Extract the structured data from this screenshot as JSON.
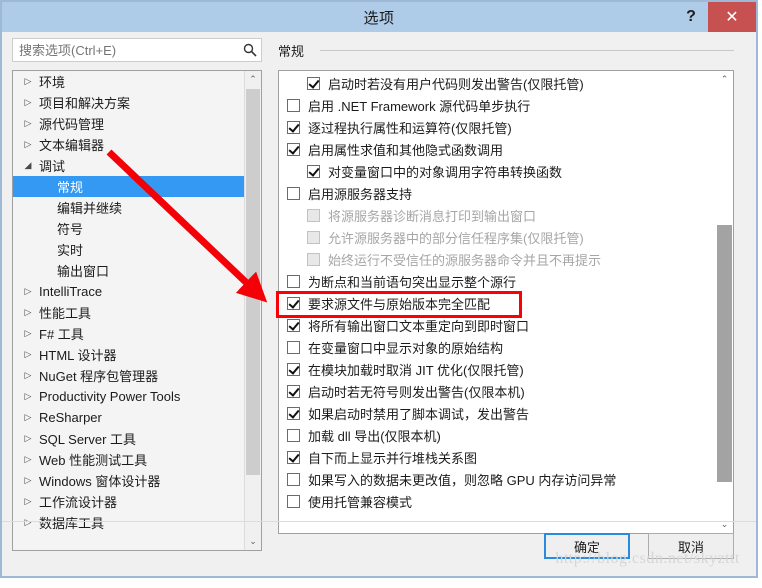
{
  "window": {
    "title": "选项",
    "help_label": "?",
    "close_label": "✕"
  },
  "search": {
    "placeholder": "搜索选项(Ctrl+E)",
    "value": "",
    "icon": "search-icon"
  },
  "section": {
    "title": "常规"
  },
  "tree": {
    "items": [
      {
        "label": "环境",
        "expander": "▷",
        "level": 0,
        "selected": false
      },
      {
        "label": "项目和解决方案",
        "expander": "▷",
        "level": 0,
        "selected": false
      },
      {
        "label": "源代码管理",
        "expander": "▷",
        "level": 0,
        "selected": false
      },
      {
        "label": "文本编辑器",
        "expander": "▷",
        "level": 0,
        "selected": false
      },
      {
        "label": "调试",
        "expander": "◢",
        "level": 0,
        "selected": false
      },
      {
        "label": "常规",
        "expander": "",
        "level": 1,
        "selected": true
      },
      {
        "label": "编辑并继续",
        "expander": "",
        "level": 1,
        "selected": false
      },
      {
        "label": "符号",
        "expander": "",
        "level": 1,
        "selected": false
      },
      {
        "label": "实时",
        "expander": "",
        "level": 1,
        "selected": false
      },
      {
        "label": "输出窗口",
        "expander": "",
        "level": 1,
        "selected": false
      },
      {
        "label": "IntelliTrace",
        "expander": "▷",
        "level": 0,
        "selected": false
      },
      {
        "label": "性能工具",
        "expander": "▷",
        "level": 0,
        "selected": false
      },
      {
        "label": "F# 工具",
        "expander": "▷",
        "level": 0,
        "selected": false
      },
      {
        "label": "HTML 设计器",
        "expander": "▷",
        "level": 0,
        "selected": false
      },
      {
        "label": "NuGet 程序包管理器",
        "expander": "▷",
        "level": 0,
        "selected": false
      },
      {
        "label": "Productivity Power Tools",
        "expander": "▷",
        "level": 0,
        "selected": false
      },
      {
        "label": "ReSharper",
        "expander": "▷",
        "level": 0,
        "selected": false
      },
      {
        "label": "SQL Server 工具",
        "expander": "▷",
        "level": 0,
        "selected": false
      },
      {
        "label": "Web 性能测试工具",
        "expander": "▷",
        "level": 0,
        "selected": false
      },
      {
        "label": "Windows 窗体设计器",
        "expander": "▷",
        "level": 0,
        "selected": false
      },
      {
        "label": "工作流设计器",
        "expander": "▷",
        "level": 0,
        "selected": false
      },
      {
        "label": "数据库工具",
        "expander": "▷",
        "level": 0,
        "selected": false
      }
    ],
    "scrollbar": {
      "up": "⌃",
      "down": "⌄"
    }
  },
  "options": {
    "items": [
      {
        "label": "启动时若没有用户代码则发出警告(仅限托管)",
        "checked": true,
        "disabled": false,
        "indent": true
      },
      {
        "label": "启用 .NET Framework 源代码单步执行",
        "checked": false,
        "disabled": false,
        "indent": false
      },
      {
        "label": "逐过程执行属性和运算符(仅限托管)",
        "checked": true,
        "disabled": false,
        "indent": false
      },
      {
        "label": "启用属性求值和其他隐式函数调用",
        "checked": true,
        "disabled": false,
        "indent": false
      },
      {
        "label": "对变量窗口中的对象调用字符串转换函数",
        "checked": true,
        "disabled": false,
        "indent": true
      },
      {
        "label": "启用源服务器支持",
        "checked": false,
        "disabled": false,
        "indent": false
      },
      {
        "label": "将源服务器诊断消息打印到输出窗口",
        "checked": false,
        "disabled": true,
        "indent": true
      },
      {
        "label": "允许源服务器中的部分信任程序集(仅限托管)",
        "checked": false,
        "disabled": true,
        "indent": true
      },
      {
        "label": "始终运行不受信任的源服务器命令并且不再提示",
        "checked": false,
        "disabled": true,
        "indent": true
      },
      {
        "label": "为断点和当前语句突出显示整个源行",
        "checked": false,
        "disabled": false,
        "indent": false
      },
      {
        "label": "要求源文件与原始版本完全匹配",
        "checked": true,
        "disabled": false,
        "indent": false
      },
      {
        "label": "将所有输出窗口文本重定向到即时窗口",
        "checked": true,
        "disabled": false,
        "indent": false
      },
      {
        "label": "在变量窗口中显示对象的原始结构",
        "checked": false,
        "disabled": false,
        "indent": false
      },
      {
        "label": "在模块加载时取消 JIT 优化(仅限托管)",
        "checked": true,
        "disabled": false,
        "indent": false
      },
      {
        "label": "启动时若无符号则发出警告(仅限本机)",
        "checked": true,
        "disabled": false,
        "indent": false
      },
      {
        "label": "如果启动时禁用了脚本调试，发出警告",
        "checked": true,
        "disabled": false,
        "indent": false
      },
      {
        "label": "加载 dll 导出(仅限本机)",
        "checked": false,
        "disabled": false,
        "indent": false
      },
      {
        "label": "自下而上显示并行堆栈关系图",
        "checked": true,
        "disabled": false,
        "indent": false
      },
      {
        "label": "如果写入的数据未更改值，则忽略 GPU 内存访问异常",
        "checked": false,
        "disabled": false,
        "indent": false
      },
      {
        "label": "使用托管兼容模式",
        "checked": false,
        "disabled": false,
        "indent": false
      }
    ],
    "scrollbar": {
      "up": "⌃",
      "down": "⌄"
    }
  },
  "footer": {
    "ok_label": "确定",
    "cancel_label": "取消"
  },
  "annotations": {
    "highlight_color": "#fb0005",
    "arrow_color": "#f40007",
    "watermark": "http://blog.csdn.net/skyzttt"
  }
}
